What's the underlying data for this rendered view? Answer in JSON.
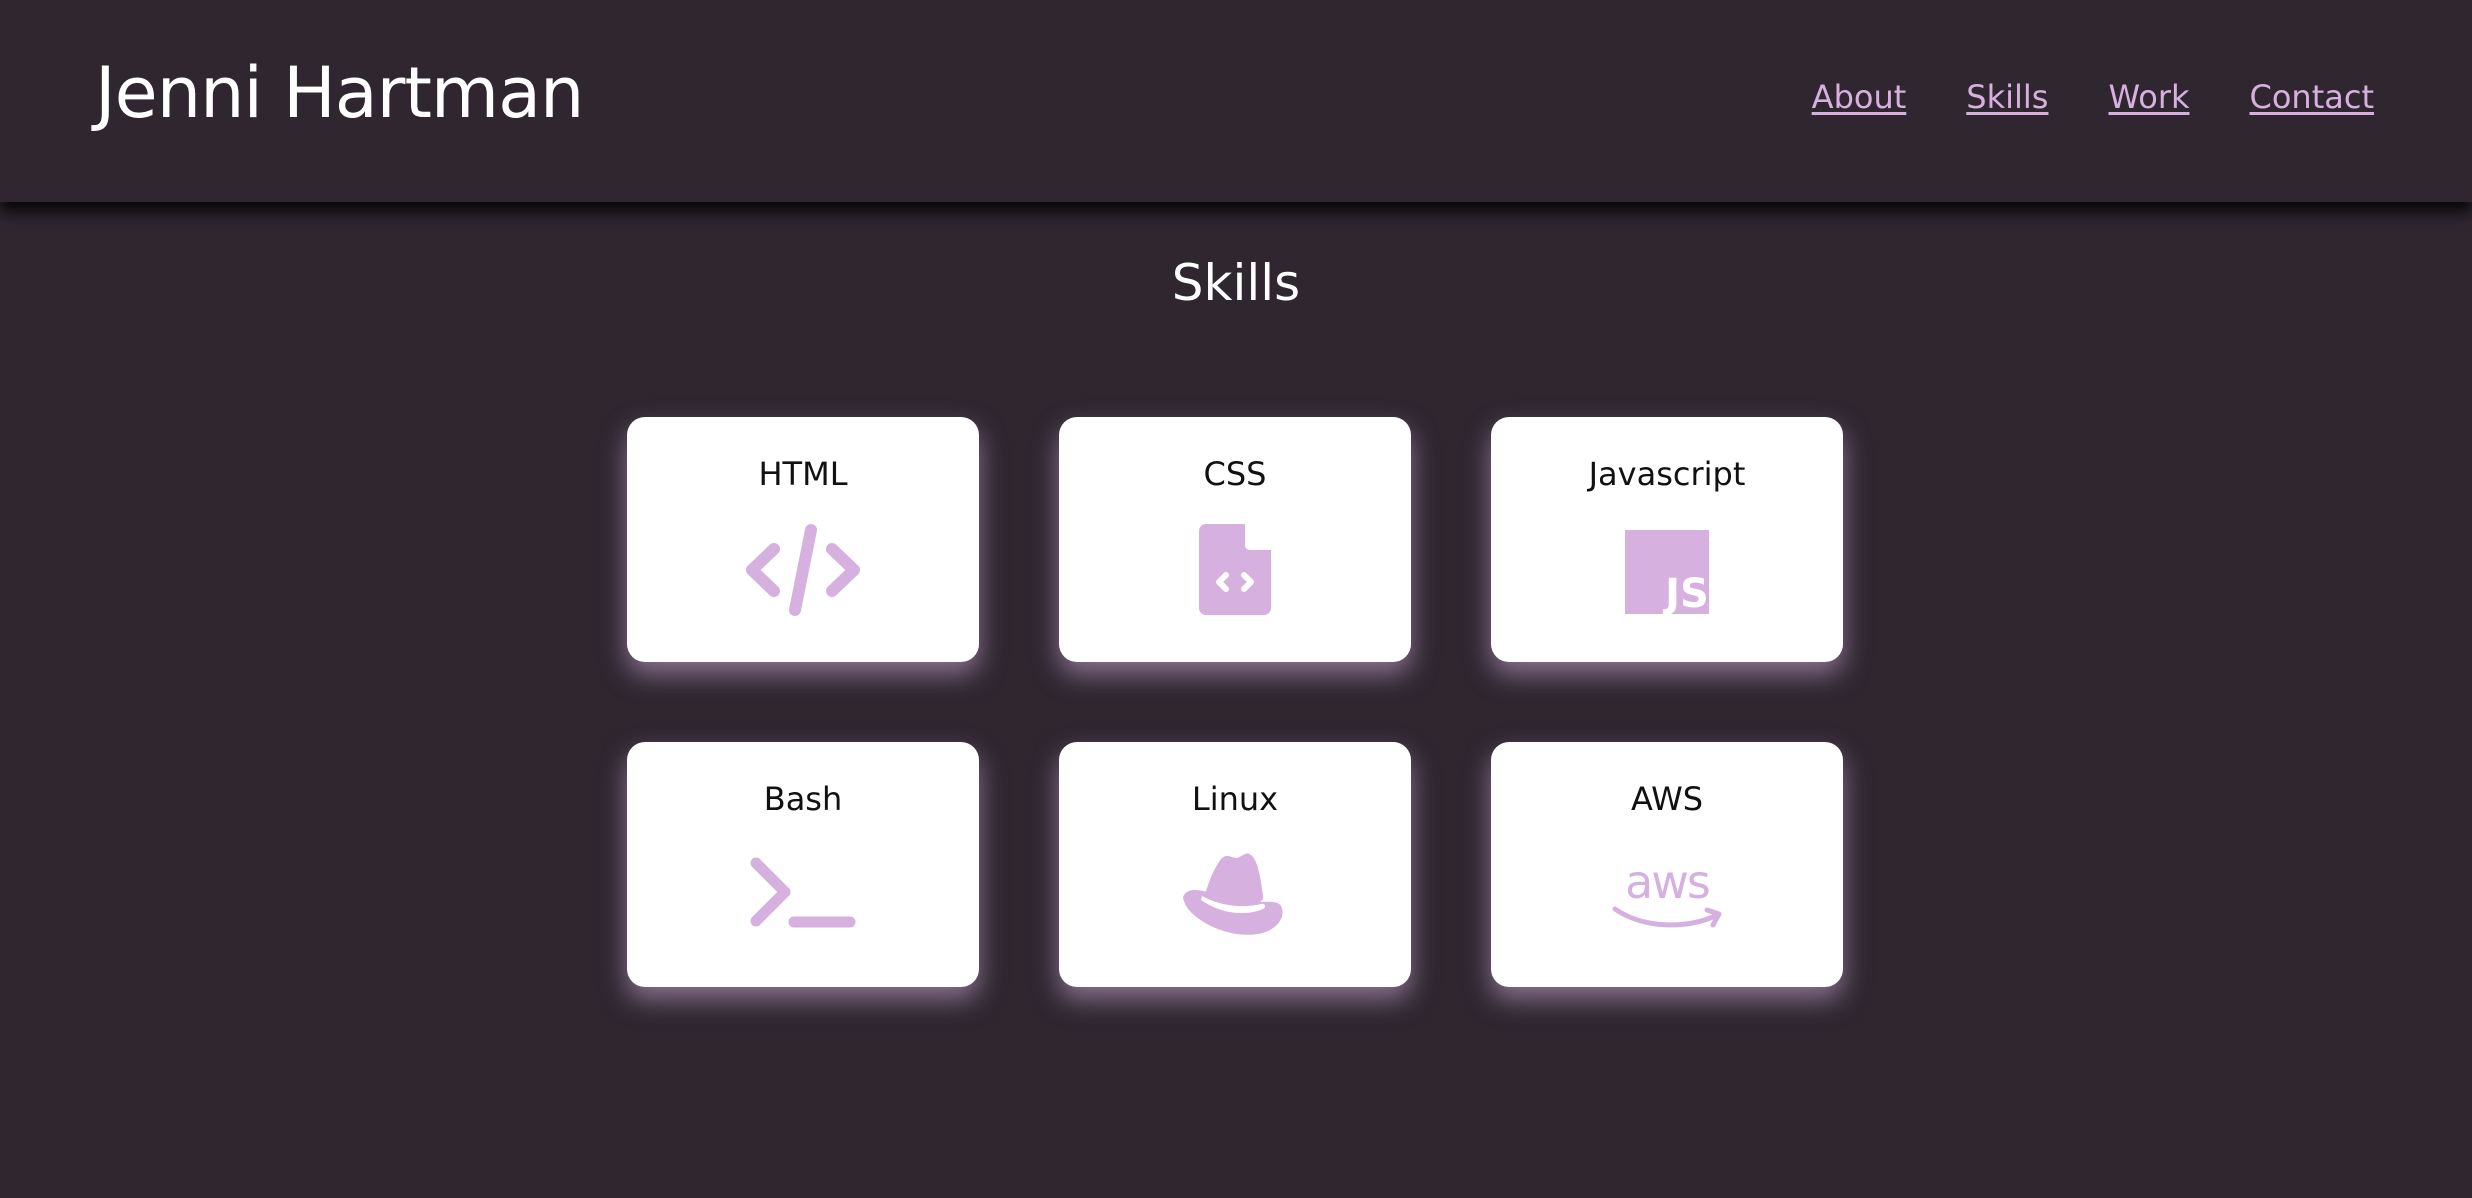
{
  "header": {
    "title": "Jenni Hartman",
    "nav": [
      "About",
      "Skills",
      "Work",
      "Contact"
    ]
  },
  "skills": {
    "title": "Skills",
    "cards": [
      {
        "label": "HTML",
        "icon": "code-icon"
      },
      {
        "label": "CSS",
        "icon": "code-file-icon"
      },
      {
        "label": "Javascript",
        "icon": "js-icon"
      },
      {
        "label": "Bash",
        "icon": "terminal-icon"
      },
      {
        "label": "Linux",
        "icon": "redhat-icon"
      },
      {
        "label": "AWS",
        "icon": "aws-icon"
      }
    ]
  },
  "colors": {
    "background": "#2f2630",
    "accent": "#d6b0de",
    "card": "#ffffff"
  }
}
